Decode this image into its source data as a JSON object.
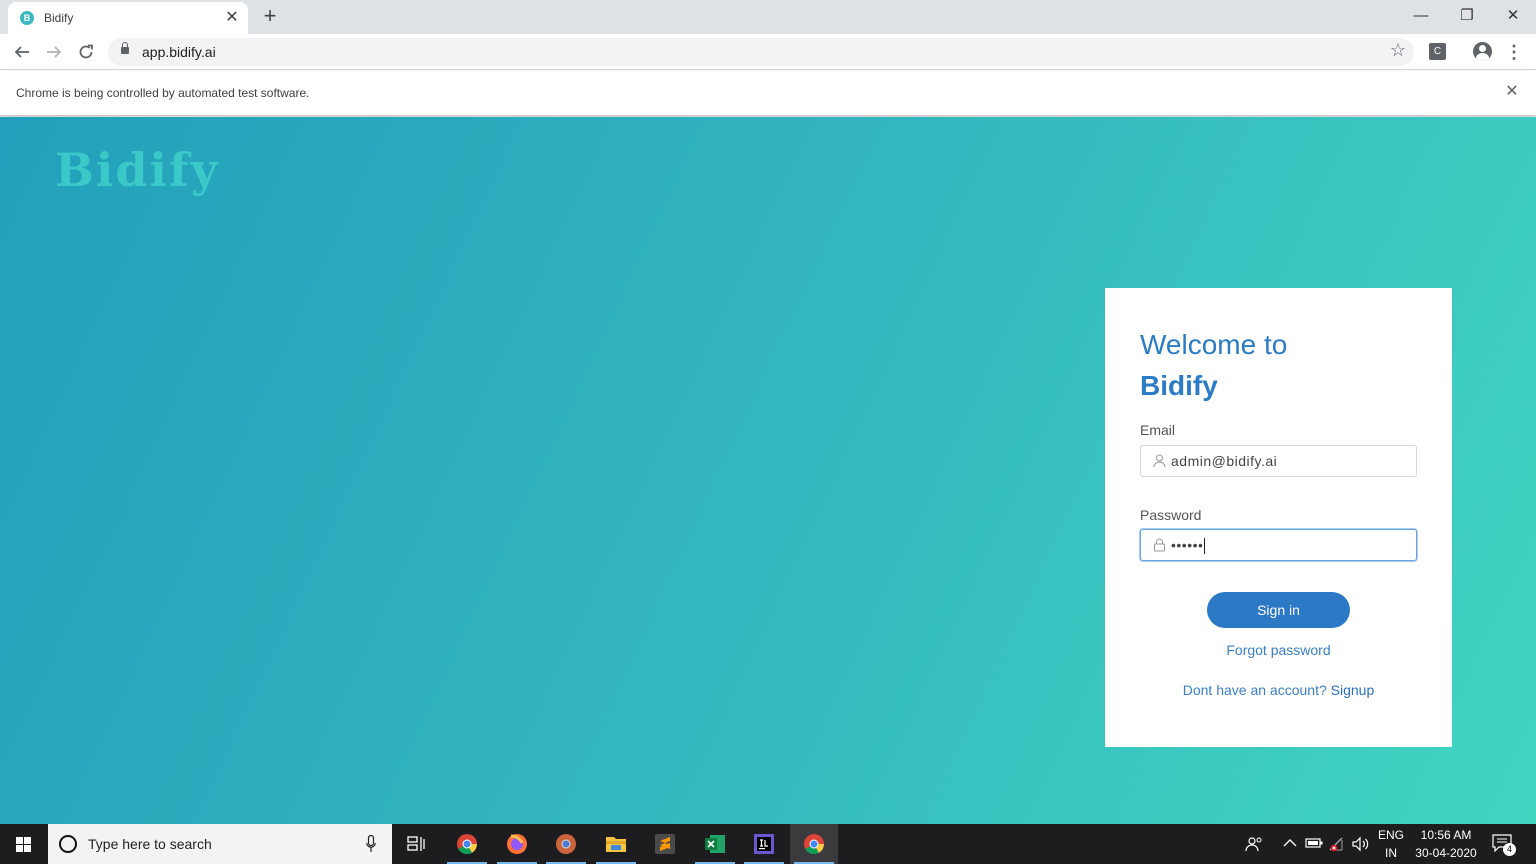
{
  "browser": {
    "tab": {
      "title": "Bidify",
      "favicon_letter": "B",
      "close_glyph": "✕"
    },
    "new_tab_glyph": "+",
    "window_controls": {
      "minimize": "—",
      "restore": "❐",
      "close": "✕"
    },
    "url": "app.bidify.ai",
    "extension_letter": "C",
    "infobar_text": "Chrome is being controlled by automated test software.",
    "infobar_close": "✕"
  },
  "page": {
    "logo_text": "Bidify",
    "login": {
      "welcome_line": "Welcome to",
      "brand_line": "Bidify",
      "email_label": "Email",
      "email_value": "admin@bidify.ai",
      "password_label": "Password",
      "password_value": "••••••",
      "signin_label": "Sign in",
      "forgot_label": "Forgot password",
      "signup_prompt": "Dont have an account? ",
      "signup_link": "Signup"
    }
  },
  "taskbar": {
    "search_placeholder": "Type here to search",
    "language": "ENG",
    "region": "IN",
    "time": "10:56 AM",
    "date": "30-04-2020",
    "notification_count": "4"
  },
  "colors": {
    "accent": "#2b78c5",
    "gradient_start": "#22a0bb",
    "gradient_end": "#42d5c0"
  }
}
